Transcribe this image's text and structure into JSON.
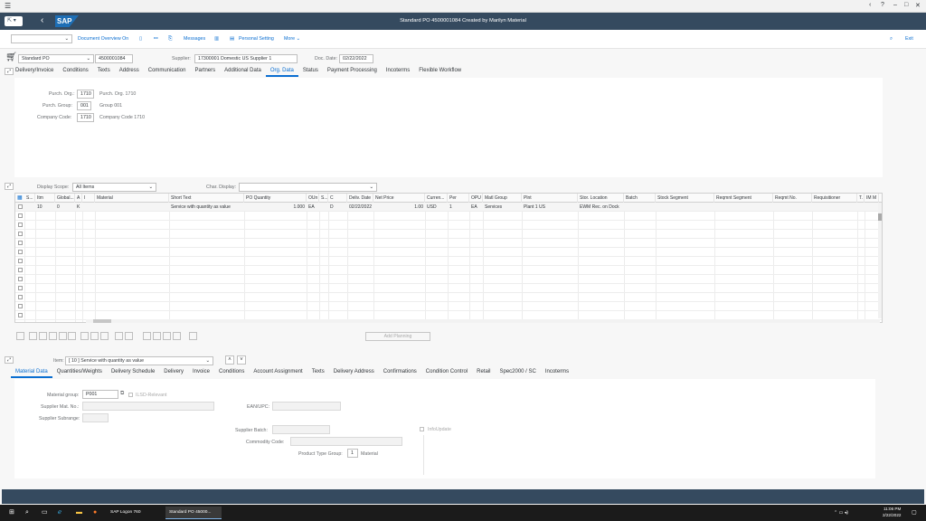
{
  "window": {
    "title": "Standard PO 4500001084 Created by Marilyn Material",
    "controls": [
      "‹",
      "?",
      "–",
      "□",
      "✕"
    ]
  },
  "toolbar": {
    "doc_overview": "Document Overview On",
    "messages": "Messages",
    "personal_setting": "Personal Setting",
    "more": "More",
    "exit": "Exit"
  },
  "header": {
    "doc_type": "Standard PO",
    "po_number": "4500001084",
    "supplier_label": "Supplier:",
    "supplier_value": "17300001 Domestic US Supplier 1",
    "doc_date_label": "Doc. Date:",
    "doc_date_value": "02/22/2022"
  },
  "header_tabs": [
    "Delivery/Invoice",
    "Conditions",
    "Texts",
    "Address",
    "Communication",
    "Partners",
    "Additional Data",
    "Org. Data",
    "Status",
    "Payment Processing",
    "Incoterms",
    "Flexible Workflow"
  ],
  "org": {
    "purch_org_label": "Purch. Org.:",
    "purch_org_code": "1710",
    "purch_org_text": "Purch. Org. 1710",
    "purch_group_label": "Purch. Group:",
    "purch_group_code": "001",
    "purch_group_text": "Group 001",
    "company_code_label": "Company Code:",
    "company_code_code": "1710",
    "company_code_text": "Company Code 1710"
  },
  "items": {
    "display_scope_label": "Display Scope:",
    "display_scope_value": "All Items",
    "char_display_label": "Char. Display:",
    "columns": [
      "S...",
      "Itm",
      "Global...",
      "A",
      "I",
      "Material",
      "Short Text",
      "PO Quantity",
      "OUn",
      "S...",
      "C",
      "Deliv. Date",
      "Net Price",
      "Curren...",
      "Per",
      "OPU",
      "Matl Group",
      "Plnt",
      "Stor. Location",
      "Batch",
      "Stock Segment",
      "Reqmnt Segment",
      "Reqmt No.",
      "Requisitioner",
      "T.",
      "IM M"
    ],
    "row": {
      "itm": "10",
      "global": "0",
      "acct": "K",
      "short_text": "Service with quantity as value",
      "po_qty": "1.000",
      "oun": "EA",
      "c": "D",
      "deliv_date": "02/22/2022",
      "net_price": "1.00",
      "currency": "USD",
      "per": "1",
      "opu": "EA",
      "matl_group": "Services",
      "plnt": "Plant 1 US",
      "stor_loc": "EWM Rec. on Dock"
    },
    "add_planning": "Add Planning"
  },
  "item_detail": {
    "item_label": "Item:",
    "item_value": "[ 10 ] Service with quantity as value",
    "tabs": [
      "Material Data",
      "Quantities/Weights",
      "Delivery Schedule",
      "Delivery",
      "Invoice",
      "Conditions",
      "Account Assignment",
      "Texts",
      "Delivery Address",
      "Confirmations",
      "Condition Control",
      "Retail",
      "Spec2000 / SC",
      "Incoterms"
    ],
    "material_group_label": "Material group:",
    "material_group_value": "P001",
    "ilsd_label": "ILSD-Relevant",
    "supplier_mat_label": "Supplier Mat. No.:",
    "ean_label": "EAN/UPC:",
    "supplier_subrange_label": "Supplier Subrange:",
    "supplier_batch_label": "Supplier Batch:",
    "info_update_label": "InfoUpdate",
    "commodity_code_label": "Commodity Code:",
    "product_type_label": "Product Type Group:",
    "product_type_code": "1",
    "product_type_text": "Material"
  },
  "taskbar": {
    "app1": "SAP Logon 760",
    "app2": "Standard PO 45000...",
    "time": "11:06 PM",
    "date": "2/22/2022"
  },
  "colors": {
    "shell": "#354a5f",
    "accent": "#0a6ed1",
    "taskbar": "#1b1b1b"
  }
}
